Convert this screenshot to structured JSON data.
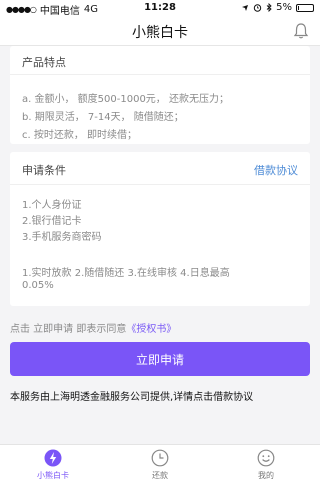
{
  "status_bar": {
    "carrier": "中国电信",
    "network": "4G",
    "time": "11:28",
    "battery_text": "5%",
    "battery_level": 0.05,
    "icons": [
      "signal-icon",
      "location-icon",
      "alarm-icon",
      "bluetooth-icon",
      "battery-icon"
    ]
  },
  "nav": {
    "title": "小熊白卡",
    "bell_icon": "bell-icon"
  },
  "features": {
    "title": "产品特点",
    "lines": [
      "a. 金额小， 额度500-1000元， 还款无压力；",
      "b. 期限灵活， 7-14天， 随借随还；",
      "c. 按时还款， 即时续借；"
    ]
  },
  "conditions": {
    "title": "申请条件",
    "protocol_link": "借款协议",
    "requirements": [
      "1.个人身份证",
      "2.银行借记卡",
      "3.手机服务商密码"
    ],
    "highlights_line1": "1.实时放款 2.随借随还 3.在线审核 4.日息最高",
    "highlights_line2": "0.05%"
  },
  "hint": {
    "prefix": "点击 立即申请 即表示同意",
    "link": "《授权书》"
  },
  "apply_button": "立即申请",
  "notice": "本服务由上海明透金融服务公司提供,详情点击借款协议",
  "tabs": [
    {
      "label": "小熊白卡",
      "icon": "lightning-icon",
      "active": true
    },
    {
      "label": "还款",
      "icon": "clock-icon",
      "active": false
    },
    {
      "label": "我的",
      "icon": "smiley-icon",
      "active": false
    }
  ],
  "colors": {
    "accent": "#7a55f7",
    "link": "#4d8bd6",
    "background": "#f4f4f6"
  }
}
